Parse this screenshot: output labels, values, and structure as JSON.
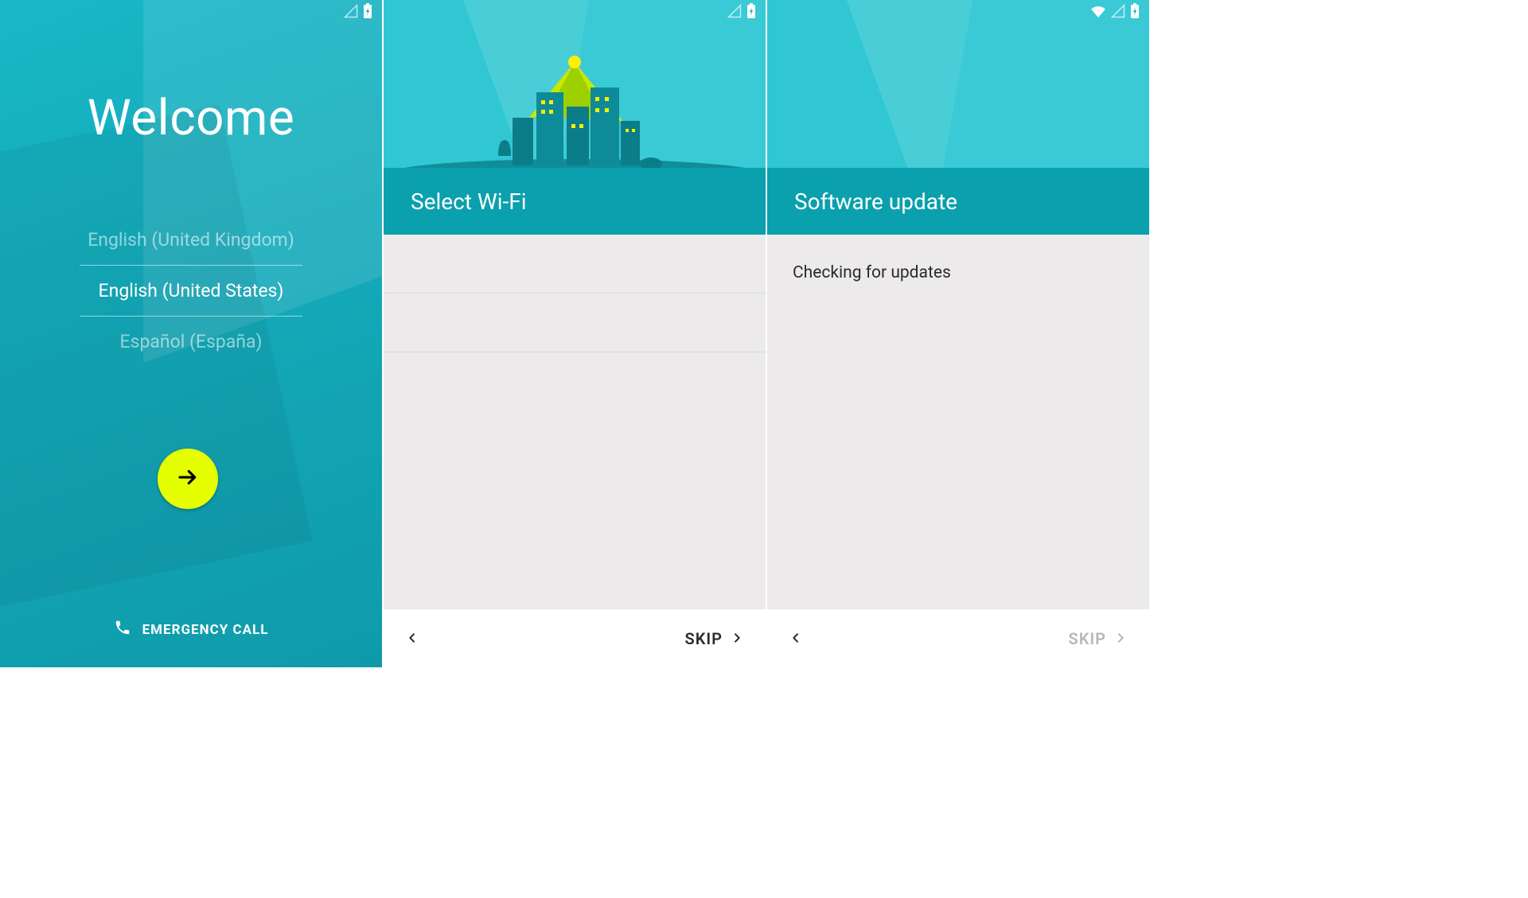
{
  "screen1": {
    "title": "Welcome",
    "languages": [
      "English (United Kingdom)",
      "English (United States)",
      "Español (España)"
    ],
    "selected_index": 1,
    "emergency_label": "EMERGENCY CALL"
  },
  "screen2": {
    "title": "Select Wi-Fi",
    "skip_label": "SKIP"
  },
  "screen3": {
    "title": "Software update",
    "status_text": "Checking for updates",
    "skip_label": "SKIP"
  }
}
